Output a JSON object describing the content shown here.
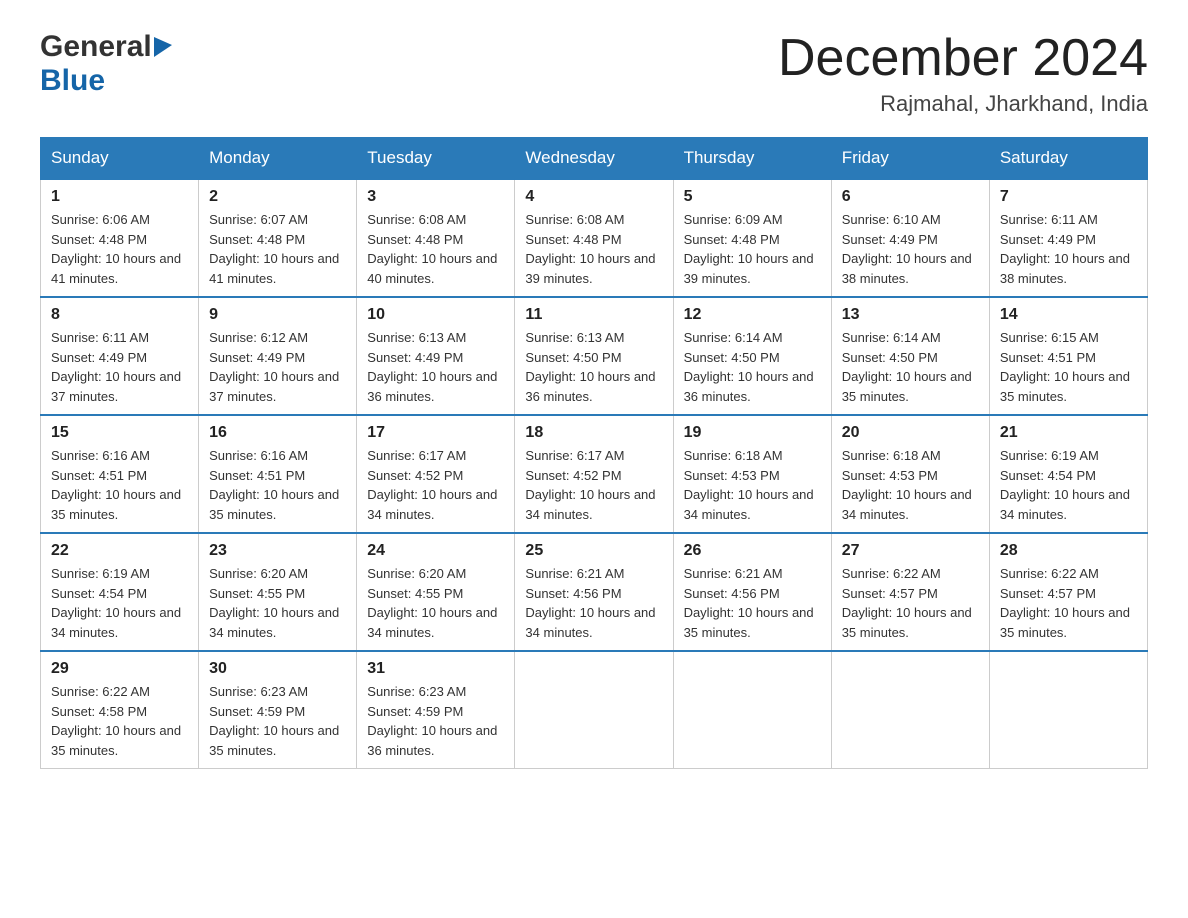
{
  "header": {
    "logo_general": "General",
    "logo_blue": "Blue",
    "title": "December 2024",
    "subtitle": "Rajmahal, Jharkhand, India"
  },
  "days_of_week": [
    "Sunday",
    "Monday",
    "Tuesday",
    "Wednesday",
    "Thursday",
    "Friday",
    "Saturday"
  ],
  "weeks": [
    [
      {
        "day": "1",
        "sunrise": "6:06 AM",
        "sunset": "4:48 PM",
        "daylight": "10 hours and 41 minutes."
      },
      {
        "day": "2",
        "sunrise": "6:07 AM",
        "sunset": "4:48 PM",
        "daylight": "10 hours and 41 minutes."
      },
      {
        "day": "3",
        "sunrise": "6:08 AM",
        "sunset": "4:48 PM",
        "daylight": "10 hours and 40 minutes."
      },
      {
        "day": "4",
        "sunrise": "6:08 AM",
        "sunset": "4:48 PM",
        "daylight": "10 hours and 39 minutes."
      },
      {
        "day": "5",
        "sunrise": "6:09 AM",
        "sunset": "4:48 PM",
        "daylight": "10 hours and 39 minutes."
      },
      {
        "day": "6",
        "sunrise": "6:10 AM",
        "sunset": "4:49 PM",
        "daylight": "10 hours and 38 minutes."
      },
      {
        "day": "7",
        "sunrise": "6:11 AM",
        "sunset": "4:49 PM",
        "daylight": "10 hours and 38 minutes."
      }
    ],
    [
      {
        "day": "8",
        "sunrise": "6:11 AM",
        "sunset": "4:49 PM",
        "daylight": "10 hours and 37 minutes."
      },
      {
        "day": "9",
        "sunrise": "6:12 AM",
        "sunset": "4:49 PM",
        "daylight": "10 hours and 37 minutes."
      },
      {
        "day": "10",
        "sunrise": "6:13 AM",
        "sunset": "4:49 PM",
        "daylight": "10 hours and 36 minutes."
      },
      {
        "day": "11",
        "sunrise": "6:13 AM",
        "sunset": "4:50 PM",
        "daylight": "10 hours and 36 minutes."
      },
      {
        "day": "12",
        "sunrise": "6:14 AM",
        "sunset": "4:50 PM",
        "daylight": "10 hours and 36 minutes."
      },
      {
        "day": "13",
        "sunrise": "6:14 AM",
        "sunset": "4:50 PM",
        "daylight": "10 hours and 35 minutes."
      },
      {
        "day": "14",
        "sunrise": "6:15 AM",
        "sunset": "4:51 PM",
        "daylight": "10 hours and 35 minutes."
      }
    ],
    [
      {
        "day": "15",
        "sunrise": "6:16 AM",
        "sunset": "4:51 PM",
        "daylight": "10 hours and 35 minutes."
      },
      {
        "day": "16",
        "sunrise": "6:16 AM",
        "sunset": "4:51 PM",
        "daylight": "10 hours and 35 minutes."
      },
      {
        "day": "17",
        "sunrise": "6:17 AM",
        "sunset": "4:52 PM",
        "daylight": "10 hours and 34 minutes."
      },
      {
        "day": "18",
        "sunrise": "6:17 AM",
        "sunset": "4:52 PM",
        "daylight": "10 hours and 34 minutes."
      },
      {
        "day": "19",
        "sunrise": "6:18 AM",
        "sunset": "4:53 PM",
        "daylight": "10 hours and 34 minutes."
      },
      {
        "day": "20",
        "sunrise": "6:18 AM",
        "sunset": "4:53 PM",
        "daylight": "10 hours and 34 minutes."
      },
      {
        "day": "21",
        "sunrise": "6:19 AM",
        "sunset": "4:54 PM",
        "daylight": "10 hours and 34 minutes."
      }
    ],
    [
      {
        "day": "22",
        "sunrise": "6:19 AM",
        "sunset": "4:54 PM",
        "daylight": "10 hours and 34 minutes."
      },
      {
        "day": "23",
        "sunrise": "6:20 AM",
        "sunset": "4:55 PM",
        "daylight": "10 hours and 34 minutes."
      },
      {
        "day": "24",
        "sunrise": "6:20 AM",
        "sunset": "4:55 PM",
        "daylight": "10 hours and 34 minutes."
      },
      {
        "day": "25",
        "sunrise": "6:21 AM",
        "sunset": "4:56 PM",
        "daylight": "10 hours and 34 minutes."
      },
      {
        "day": "26",
        "sunrise": "6:21 AM",
        "sunset": "4:56 PM",
        "daylight": "10 hours and 35 minutes."
      },
      {
        "day": "27",
        "sunrise": "6:22 AM",
        "sunset": "4:57 PM",
        "daylight": "10 hours and 35 minutes."
      },
      {
        "day": "28",
        "sunrise": "6:22 AM",
        "sunset": "4:57 PM",
        "daylight": "10 hours and 35 minutes."
      }
    ],
    [
      {
        "day": "29",
        "sunrise": "6:22 AM",
        "sunset": "4:58 PM",
        "daylight": "10 hours and 35 minutes."
      },
      {
        "day": "30",
        "sunrise": "6:23 AM",
        "sunset": "4:59 PM",
        "daylight": "10 hours and 35 minutes."
      },
      {
        "day": "31",
        "sunrise": "6:23 AM",
        "sunset": "4:59 PM",
        "daylight": "10 hours and 36 minutes."
      },
      null,
      null,
      null,
      null
    ]
  ],
  "labels": {
    "sunrise_prefix": "Sunrise: ",
    "sunset_prefix": "Sunset: ",
    "daylight_prefix": "Daylight: "
  }
}
